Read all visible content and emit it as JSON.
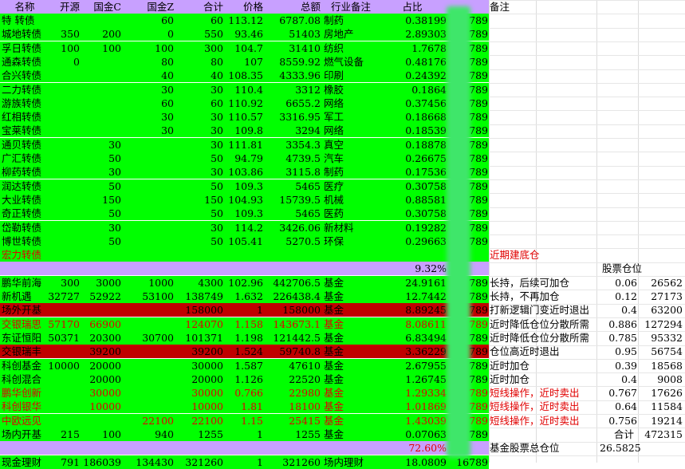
{
  "header": {
    "cells": [
      "名称",
      "开源",
      "国金C",
      "国金Z",
      "合计",
      "价格",
      "总额",
      "行业备注",
      "占比",
      "",
      "备注"
    ]
  },
  "colors": {
    "green": "#00ff00",
    "purple": "#c8a0ff",
    "darkred": "#c00000",
    "red": "#ff0000",
    "header": "#c8a0ff"
  },
  "rows": [
    {
      "bg": "green",
      "fg": "black",
      "cells": [
        "特  转债",
        "",
        "",
        "60",
        "60",
        "113.12",
        "6787.08",
        "制药",
        "0.38199",
        "789"
      ]
    },
    {
      "bg": "green",
      "fg": "black",
      "cells": [
        "城地转债",
        "350",
        "200",
        "0",
        "550",
        "93.46",
        "51403",
        "房地产",
        "2.89303",
        "789"
      ]
    },
    {
      "bg": "green",
      "fg": "black",
      "cells": [
        "孚日转债",
        "100",
        "100",
        "100",
        "300",
        "104.7",
        "31410",
        "纺织",
        "1.7678",
        "789"
      ]
    },
    {
      "bg": "green",
      "fg": "black",
      "cells": [
        "通森转债",
        "0",
        "",
        "80",
        "80",
        "107",
        "8559.92",
        "燃气设备",
        "0.48176",
        "789"
      ]
    },
    {
      "bg": "green",
      "fg": "black",
      "cells": [
        "合兴转债",
        "",
        "",
        "40",
        "40",
        "108.35",
        "4333.96",
        "印刷",
        "0.24392",
        "789"
      ]
    },
    {
      "bg": "green",
      "fg": "black",
      "cells": [
        "二力转债",
        "",
        "",
        "30",
        "30",
        "110.4",
        "3312",
        "橡胶",
        "0.1864",
        "789"
      ]
    },
    {
      "bg": "green",
      "fg": "black",
      "cells": [
        "游族转债",
        "",
        "",
        "60",
        "60",
        "110.92",
        "6655.2",
        "网络",
        "0.37456",
        "789"
      ]
    },
    {
      "bg": "green",
      "fg": "black",
      "cells": [
        "红相转债",
        "",
        "",
        "30",
        "30",
        "110.57",
        "3316.95",
        "军工",
        "0.18668",
        "789"
      ]
    },
    {
      "bg": "green",
      "fg": "black",
      "cells": [
        "宝莱转债",
        "",
        "",
        "30",
        "30",
        "109.8",
        "3294",
        "网络",
        "0.18539",
        "789"
      ]
    },
    {
      "bg": "green",
      "fg": "black",
      "cells": [
        "通贝转债",
        "",
        "30",
        "",
        "30",
        "111.81",
        "3354.3",
        "真空",
        "0.18878",
        "789"
      ]
    },
    {
      "bg": "green",
      "fg": "black",
      "cells": [
        "广汇转债",
        "",
        "50",
        "",
        "50",
        "94.79",
        "4739.5",
        "汽车",
        "0.26675",
        "789"
      ]
    },
    {
      "bg": "green",
      "fg": "black",
      "cells": [
        "柳药转债",
        "",
        "30",
        "",
        "30",
        "103.86",
        "3115.8",
        "制药",
        "0.17536",
        "789"
      ]
    },
    {
      "bg": "green",
      "fg": "black",
      "cells": [
        "润达转债",
        "",
        "50",
        "",
        "50",
        "109.3",
        "5465",
        "医疗",
        "0.30758",
        "789"
      ]
    },
    {
      "bg": "green",
      "fg": "black",
      "cells": [
        "大业转债",
        "",
        "150",
        "",
        "150",
        "104.93",
        "15739.5",
        "机械",
        "0.88581",
        "789"
      ]
    },
    {
      "bg": "green",
      "fg": "black",
      "cells": [
        "奇正转债",
        "",
        "50",
        "",
        "50",
        "109.3",
        "5465",
        "医药",
        "0.30758",
        "789"
      ]
    },
    {
      "bg": "green",
      "fg": "black",
      "cells": [
        "岱勒转债",
        "",
        "30",
        "",
        "30",
        "114.2",
        "3426.06",
        "新材料",
        "0.19282",
        "789"
      ]
    },
    {
      "bg": "green",
      "fg": "black",
      "cells": [
        "博世转债",
        "",
        "50",
        "",
        "50",
        "105.41",
        "5270.5",
        "环保",
        "0.29663",
        "789"
      ]
    },
    {
      "bg": "green",
      "fg": "red",
      "cells": [
        "宏力转债",
        "",
        "",
        "",
        "",
        "",
        "",
        "",
        "",
        ""
      ]
    },
    {
      "bg": "purple",
      "fg": "black",
      "cells": [
        "",
        "",
        "",
        "",
        "",
        "",
        "",
        "",
        "9.32%",
        ""
      ]
    },
    {
      "bg": "green",
      "fg": "black",
      "cells": [
        "鹏华前海",
        "300",
        "3000",
        "1000",
        "4300",
        "102.96",
        "442706.5",
        "基金",
        "24.9161",
        "789"
      ]
    },
    {
      "bg": "green",
      "fg": "black",
      "cells": [
        "新机遇",
        "32727",
        "52922",
        "53100",
        "138749",
        "1.632",
        "226438.4",
        "基金",
        "12.7442",
        "789"
      ]
    },
    {
      "bg": "darkred",
      "fg": "black",
      "cells": [
        "场外开基",
        "",
        "",
        "",
        "158000",
        "1",
        "158000",
        "基金",
        "8.89245",
        "789"
      ]
    },
    {
      "bg": "green",
      "fg": "red",
      "cells": [
        "交银瑞思",
        "57170",
        "66900",
        "",
        "124070",
        "1.158",
        "143673.1",
        "基金",
        "8.08611",
        "789"
      ]
    },
    {
      "bg": "green",
      "fg": "black",
      "cells": [
        "东证恒阳",
        "50371",
        "20300",
        "30700",
        "101371",
        "1.198",
        "121442.5",
        "基金",
        "6.83494",
        "789"
      ]
    },
    {
      "bg": "darkred",
      "fg": "black",
      "cells": [
        "交银瑞丰",
        "",
        "39200",
        "",
        "39200",
        "1.524",
        "59740.8",
        "基金",
        "3.36229",
        "789"
      ]
    },
    {
      "bg": "green",
      "fg": "black",
      "cells": [
        "科创基金",
        "10000",
        "20000",
        "",
        "30000",
        "1.587",
        "47610",
        "基金",
        "2.67955",
        "789"
      ]
    },
    {
      "bg": "green",
      "fg": "black",
      "cells": [
        "科创混合",
        "",
        "20000",
        "",
        "20000",
        "1.126",
        "22520",
        "基金",
        "1.26745",
        "789"
      ]
    },
    {
      "bg": "green",
      "fg": "red",
      "cells": [
        "鹏华创新",
        "",
        "30000",
        "",
        "30000",
        "0.766",
        "22980",
        "基金",
        "1.29334",
        "789"
      ]
    },
    {
      "bg": "green",
      "fg": "red",
      "cells": [
        "科创银华",
        "",
        "10000",
        "",
        "10000",
        "1.81",
        "18100",
        "基金",
        "1.01869",
        "789"
      ]
    },
    {
      "bg": "green",
      "fg": "red",
      "cells": [
        "中欧远见",
        "",
        "",
        "22100",
        "22100",
        "1.15",
        "25415",
        "基金",
        "1.43039",
        "789"
      ]
    },
    {
      "bg": "green",
      "fg": "black",
      "cells": [
        "场内开基",
        "215",
        "100",
        "940",
        "1255",
        "1",
        "1255",
        "基金",
        "0.07063",
        "789"
      ]
    },
    {
      "bg": "purple",
      "fg": "red",
      "cells": [
        "",
        "",
        "",
        "",
        "",
        "",
        "",
        "",
        "72.60%",
        ""
      ]
    },
    {
      "bg": "green",
      "fg": "black",
      "cells": [
        "现金理财",
        "791",
        "186039",
        "134430",
        "321260",
        "1",
        "321260",
        "场内理财",
        "18.0809",
        "16789"
      ]
    }
  ],
  "notes": [
    {
      "row": 17,
      "text": "近期建底仓",
      "red": true
    },
    {
      "row": 19,
      "text": "长持，后续可加仓",
      "red": false
    },
    {
      "row": 20,
      "text": "长持，不再加仓",
      "red": false
    },
    {
      "row": 21,
      "text": "打新逻辑门变近时退出",
      "red": false
    },
    {
      "row": 22,
      "text": "近时降低仓位分散所需",
      "red": false
    },
    {
      "row": 23,
      "text": "近时降低仓位分散所需",
      "red": false
    },
    {
      "row": 24,
      "text": "仓位高近时退出",
      "red": false
    },
    {
      "row": 25,
      "text": "近时加仓",
      "red": false
    },
    {
      "row": 26,
      "text": "近时加仓",
      "red": false
    },
    {
      "row": 27,
      "text": "短线操作，近时卖出",
      "red": true
    },
    {
      "row": 28,
      "text": "短线操作，近时卖出",
      "red": true
    },
    {
      "row": 29,
      "text": "短线操作，近时卖出",
      "red": true
    },
    {
      "row": 31,
      "text": "基金股票总仓位",
      "red": false
    }
  ],
  "right_panel": {
    "title": "股票仓位",
    "rows": [
      {
        "row": 19,
        "ratio": "0.06",
        "amount": "26562"
      },
      {
        "row": 20,
        "ratio": "0.12",
        "amount": "27173"
      },
      {
        "row": 21,
        "ratio": "0.4",
        "amount": "63200"
      },
      {
        "row": 22,
        "ratio": "0.886",
        "amount": "127294"
      },
      {
        "row": 23,
        "ratio": "0.785",
        "amount": "95332"
      },
      {
        "row": 24,
        "ratio": "0.95",
        "amount": "56754"
      },
      {
        "row": 25,
        "ratio": "0.39",
        "amount": "18568"
      },
      {
        "row": 26,
        "ratio": "0.4",
        "amount": "9008"
      },
      {
        "row": 27,
        "ratio": "0.767",
        "amount": "17626"
      },
      {
        "row": 28,
        "ratio": "0.64",
        "amount": "11584"
      },
      {
        "row": 29,
        "ratio": "0.756",
        "amount": "19214"
      }
    ],
    "total_label": "合计",
    "total_value": "472315",
    "position_value": "26.5825"
  }
}
